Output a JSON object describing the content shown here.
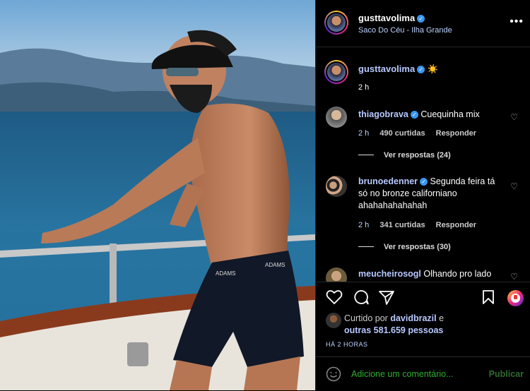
{
  "post": {
    "username": "gusttavolima",
    "location": "Saco Do Céu - Ilha Grande",
    "caption": "☀️",
    "caption_time": "2 h"
  },
  "comments": [
    {
      "username": "thiagobrava",
      "verified": true,
      "text": "Cuequinha mix",
      "time": "2 h",
      "likes": "490 curtidas",
      "reply": "Responder",
      "view_replies": "Ver respostas (24)"
    },
    {
      "username": "brunoedenner",
      "verified": true,
      "text": "Segunda feira tá só no bronze californiano ahahahahahahah",
      "time": "2 h",
      "likes": "341 curtidas",
      "reply": "Responder",
      "view_replies": "Ver respostas (30)"
    },
    {
      "username": "meucheirosogl",
      "verified": false,
      "text": "Olhando pro lado"
    }
  ],
  "likes": {
    "prefix": "Curtido por",
    "user": "davidbrazil",
    "connector": "e",
    "others": "outras 581.659 pessoas"
  },
  "time_ago": "HÁ 2 HORAS",
  "add_comment": {
    "placeholder": "Adicione um comentário...",
    "publish": "Publicar"
  },
  "icons": {
    "like": "heart-icon",
    "comment": "comment-icon",
    "share": "share-icon",
    "save": "bookmark-icon",
    "emoji": "emoji-icon",
    "more": "more-icon"
  },
  "colors": {
    "verified": "#3897f0",
    "link_text": "#b8c8ff",
    "publish": "#2f6b2f"
  }
}
